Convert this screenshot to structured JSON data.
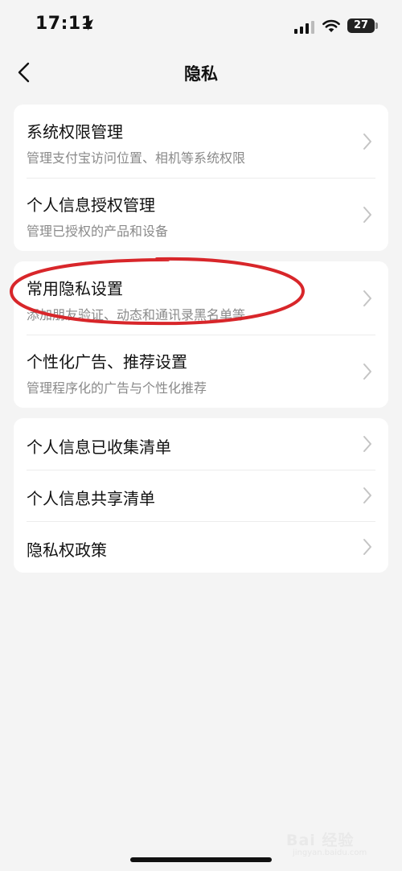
{
  "status_bar": {
    "time": "17:11",
    "battery": "27"
  },
  "nav": {
    "title": "隐私",
    "back_icon": "chevron-left-icon"
  },
  "groups": [
    {
      "items": [
        {
          "title": "系统权限管理",
          "subtitle": "管理支付宝访问位置、相机等系统权限"
        },
        {
          "title": "个人信息授权管理",
          "subtitle": "管理已授权的产品和设备"
        }
      ]
    },
    {
      "items": [
        {
          "title": "常用隐私设置",
          "subtitle": "添加朋友验证、动态和通讯录黑名单等"
        },
        {
          "title": "个性化广告、推荐设置",
          "subtitle": "管理程序化的广告与个性化推荐"
        }
      ]
    },
    {
      "items": [
        {
          "title": "个人信息已收集清单"
        },
        {
          "title": "个人信息共享清单"
        },
        {
          "title": "隐私权政策"
        }
      ]
    }
  ],
  "annotation": {
    "shape": "ellipse",
    "color": "#d8262a",
    "target": "常用隐私设置"
  },
  "watermark": {
    "text": "Bai 经验",
    "sub": "jingyan.baidu.com"
  },
  "colors": {
    "background": "#f4f4f4",
    "card": "#ffffff",
    "subtitle": "#8a8a8a",
    "chevron": "#c4c4c4"
  }
}
